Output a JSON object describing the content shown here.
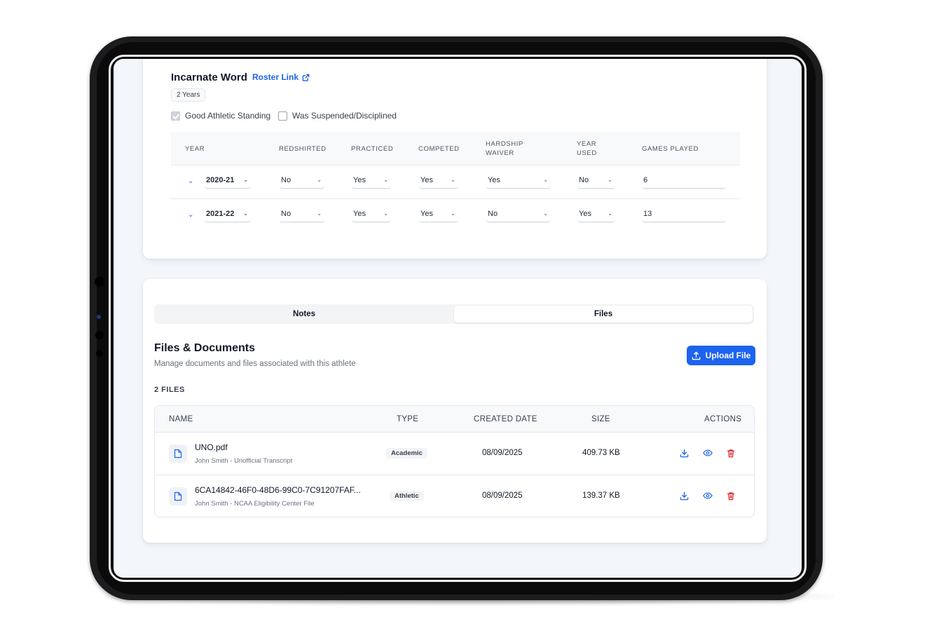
{
  "eligibility": {
    "school": "Incarnate Word",
    "roster_link": "Roster Link",
    "years_badge": "2 Years",
    "good_standing_label": "Good Athletic Standing",
    "good_standing_checked": true,
    "suspended_label": "Was Suspended/Disciplined",
    "suspended_checked": false,
    "columns": {
      "year": "YEAR",
      "redshirted": "REDSHIRTED",
      "practiced": "PRACTICED",
      "competed": "COMPETED",
      "hardship_line1": "HARDSHIP",
      "hardship_line2": "WAIVER",
      "year_used_line1": "YEAR",
      "year_used_line2": "USED",
      "games_played": "GAMES PLAYED"
    },
    "rows": [
      {
        "year": "2020-21",
        "redshirted": "No",
        "practiced": "Yes",
        "competed": "Yes",
        "hardship": "Yes",
        "year_used": "No",
        "games": "6"
      },
      {
        "year": "2021-22",
        "redshirted": "No",
        "practiced": "Yes",
        "competed": "Yes",
        "hardship": "No",
        "year_used": "Yes",
        "games": "13"
      }
    ]
  },
  "tabs": {
    "notes": "Notes",
    "files": "Files",
    "active": "Files"
  },
  "files": {
    "title": "Files & Documents",
    "subtitle": "Manage documents and files associated with this athlete",
    "upload_label": "Upload File",
    "count_label": "2 FILES",
    "columns": {
      "name": "NAME",
      "type": "TYPE",
      "created": "CREATED DATE",
      "size": "SIZE",
      "actions": "ACTIONS"
    },
    "rows": [
      {
        "name": "UNO.pdf",
        "desc": "John Smith - Unofficial Transcript",
        "type": "Academic",
        "created": "08/09/2025",
        "size": "409.73 KB"
      },
      {
        "name": "6CA14842-46F0-48D6-99C0-7C91207FAF...",
        "desc": "John Smith - NCAA Eligibility Center File",
        "type": "Athletic",
        "created": "08/09/2025",
        "size": "139.37 KB"
      }
    ]
  },
  "colors": {
    "accent": "#1d63ed",
    "danger": "#dc2626",
    "bezel": "#1c1c1e",
    "screen_bg": "#f3f6fb"
  }
}
